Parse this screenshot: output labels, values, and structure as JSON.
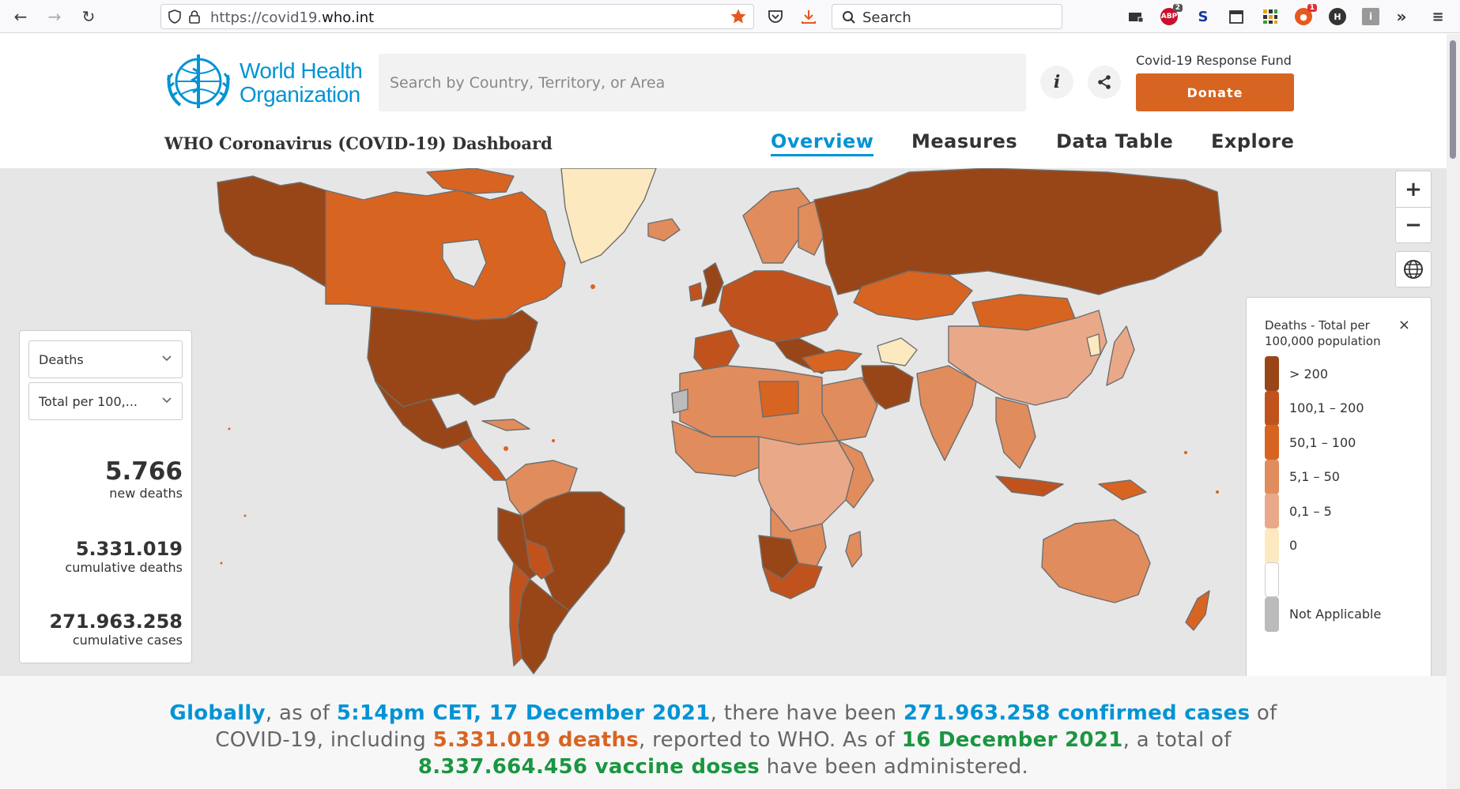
{
  "browser": {
    "url_prefix": "https://covid19.",
    "url_host": "who.int",
    "search_label": "Search",
    "ext_badges": {
      "abp": "2",
      "notif": "1"
    }
  },
  "header": {
    "logo_line1": "World Health",
    "logo_line2": "Organization",
    "search_placeholder": "Search by Country, Territory, or Area",
    "fund_label": "Covid-19 Response Fund",
    "donate_label": "Donate",
    "dashboard_title": "WHO Coronavirus (COVID-19) Dashboard",
    "nav": {
      "overview": "Overview",
      "measures": "Measures",
      "data_table": "Data Table",
      "explore": "Explore"
    }
  },
  "panel": {
    "metric_select": "Deaths",
    "measure_select": "Total per 100,...",
    "new_deaths": "5.766",
    "new_deaths_label": "new deaths",
    "cum_deaths": "5.331.019",
    "cum_deaths_label": "cumulative deaths",
    "cum_cases": "271.963.258",
    "cum_cases_label": "cumulative cases"
  },
  "map_controls": {
    "zoom_in": "+",
    "zoom_out": "−"
  },
  "legend": {
    "title": "Deaths - Total per 100,000 population",
    "close": "×",
    "items": [
      {
        "label": "> 200",
        "color": "#984617"
      },
      {
        "label": "100,1 – 200",
        "color": "#c0531d"
      },
      {
        "label": "50,1 – 100",
        "color": "#d86422"
      },
      {
        "label": "5,1 – 50",
        "color": "#e18c5c"
      },
      {
        "label": "0,1 – 5",
        "color": "#e9a988"
      },
      {
        "label": "0",
        "color": "#fde9bf"
      },
      {
        "label": "",
        "color": "#ffffff"
      },
      {
        "label": "Not Applicable",
        "color": "#bbbbbb"
      }
    ]
  },
  "summary": {
    "p1": "Globally",
    "p2": ", as of ",
    "p3": "5:14pm CET, 17 December 2021",
    "p4": ", there have been ",
    "p5": "271.963.258 confirmed cases",
    "p6": " of COVID-19, including ",
    "p7": "5.331.019 deaths",
    "p8": ", reported to WHO. As of ",
    "p9": "16 December 2021",
    "p10": ", a total of ",
    "p11": "8.337.664.456 vaccine doses",
    "p12": " have been administered."
  },
  "colors": {
    "accent": "#0093d5",
    "brand_orange": "#d86422",
    "green": "#1a9641"
  }
}
